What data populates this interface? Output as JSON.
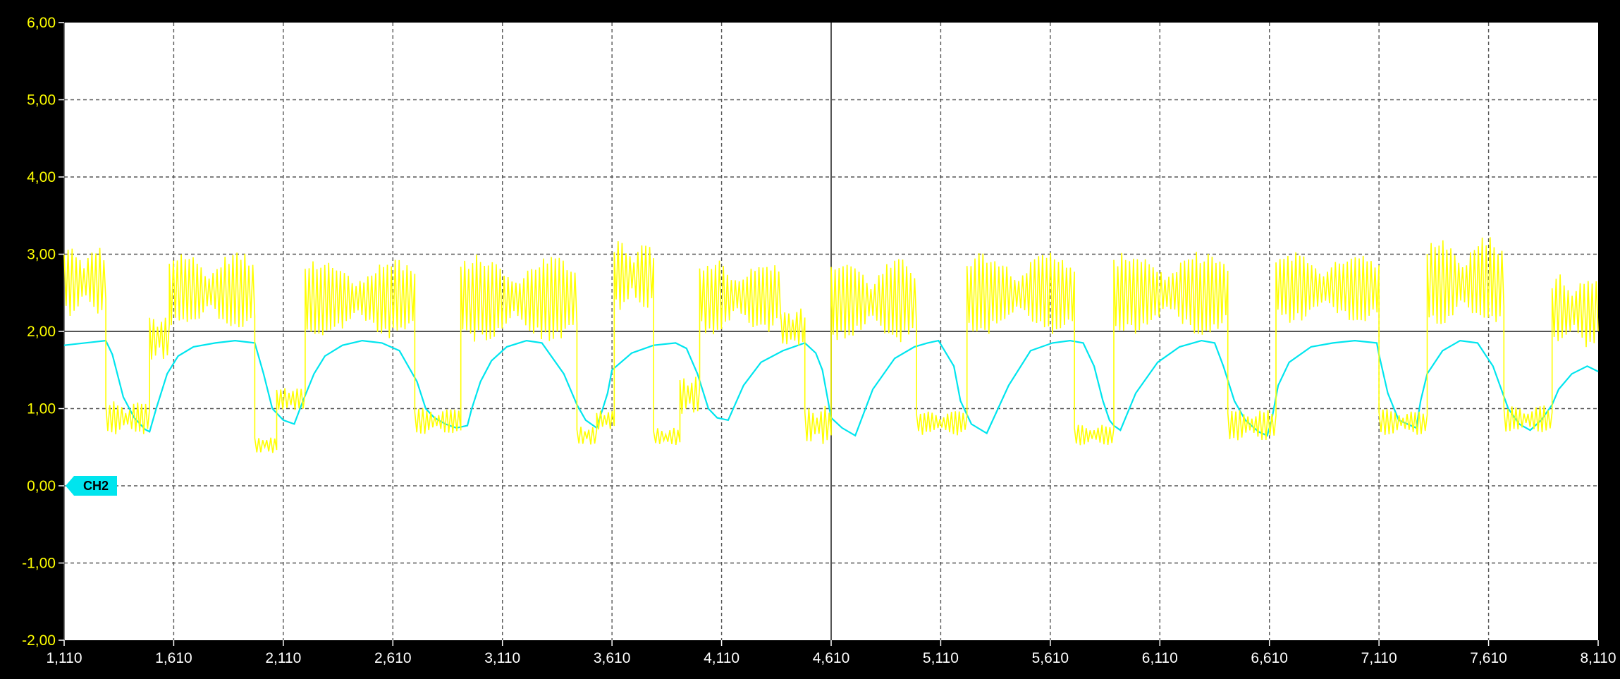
{
  "chart_data": {
    "type": "line",
    "title": "",
    "xlabel": "",
    "ylabel": "",
    "xlim": [
      1110,
      8110
    ],
    "ylim": [
      -2.0,
      6.0
    ],
    "grid": true,
    "x_ticks": [
      1110,
      1610,
      2110,
      2610,
      3110,
      3610,
      4110,
      4610,
      5110,
      5610,
      6110,
      6610,
      7110,
      7610,
      8110
    ],
    "x_tick_labels": [
      "1,110",
      "1,610",
      "2,110",
      "2,610",
      "3,110",
      "3,610",
      "4,110",
      "4,610",
      "5,110",
      "5,610",
      "6,110",
      "6,610",
      "7,110",
      "7,610",
      "8,110"
    ],
    "y_ticks": [
      6,
      5,
      4,
      3,
      2,
      1,
      0,
      -1,
      -2
    ],
    "y_tick_labels": [
      "6,00",
      "5,00",
      "4,00",
      "3,00",
      "2,00",
      "1,00",
      "0,00",
      "-1,00",
      "-2,00"
    ],
    "reference_lines": {
      "horizontal_y": 2.0,
      "vertical_x": 4610
    },
    "channel_marker": {
      "label": "CH2",
      "y": 0.0,
      "color": "#00e5ee"
    },
    "colors": {
      "background": "#000000",
      "plot_area": "#ffffff",
      "grid": "#555555",
      "reference": "#555555",
      "y_tick_text": "#ffff00",
      "x_tick_text": "#ffffff"
    },
    "series": [
      {
        "color": "#00e5ee",
        "x": [
          1110,
          1300,
          1330,
          1380,
          1430,
          1480,
          1500,
          1530,
          1580,
          1630,
          1700,
          1800,
          1890,
          1980,
          2020,
          2060,
          2110,
          2160,
          2200,
          2250,
          2300,
          2380,
          2470,
          2560,
          2640,
          2720,
          2760,
          2800,
          2850,
          2900,
          2950,
          2970,
          3010,
          3060,
          3130,
          3220,
          3290,
          3390,
          3450,
          3490,
          3540,
          3590,
          3610,
          3700,
          3800,
          3900,
          3950,
          4000,
          4050,
          4090,
          4140,
          4210,
          4290,
          4390,
          4490,
          4540,
          4570,
          4610,
          4660,
          4720,
          4800,
          4900,
          4990,
          5050,
          5100,
          5170,
          5200,
          5250,
          5320,
          5420,
          5520,
          5620,
          5700,
          5760,
          5810,
          5850,
          5880,
          5900,
          5930,
          6000,
          6100,
          6200,
          6300,
          6360,
          6400,
          6450,
          6500,
          6560,
          6600,
          6620,
          6650,
          6700,
          6800,
          6900,
          7000,
          7100,
          7110,
          7150,
          7200,
          7280,
          7300,
          7330,
          7400,
          7480,
          7560,
          7630,
          7700,
          7750,
          7800,
          7850,
          7900,
          7930,
          7990,
          8060,
          8110
        ],
        "y": [
          1.82,
          1.88,
          1.7,
          1.15,
          0.88,
          0.73,
          0.7,
          1.0,
          1.45,
          1.68,
          1.8,
          1.85,
          1.88,
          1.85,
          1.45,
          1.0,
          0.85,
          0.8,
          1.1,
          1.45,
          1.68,
          1.82,
          1.88,
          1.85,
          1.75,
          1.35,
          1.0,
          0.88,
          0.8,
          0.75,
          0.78,
          1.0,
          1.35,
          1.62,
          1.8,
          1.88,
          1.85,
          1.45,
          1.05,
          0.85,
          0.75,
          1.2,
          1.5,
          1.72,
          1.82,
          1.85,
          1.78,
          1.45,
          1.0,
          0.88,
          0.85,
          1.3,
          1.6,
          1.75,
          1.85,
          1.72,
          1.5,
          0.88,
          0.75,
          0.65,
          1.25,
          1.65,
          1.8,
          1.85,
          1.88,
          1.55,
          1.1,
          0.8,
          0.68,
          1.3,
          1.75,
          1.85,
          1.88,
          1.85,
          1.55,
          1.1,
          0.85,
          0.78,
          0.72,
          1.2,
          1.6,
          1.8,
          1.88,
          1.85,
          1.55,
          1.1,
          0.85,
          0.7,
          0.65,
          0.85,
          1.3,
          1.6,
          1.8,
          1.85,
          1.88,
          1.85,
          1.7,
          1.2,
          0.85,
          0.75,
          1.1,
          1.45,
          1.75,
          1.88,
          1.85,
          1.55,
          1.0,
          0.8,
          0.72,
          0.85,
          1.05,
          1.25,
          1.45,
          1.55,
          1.48
        ]
      },
      {
        "color": "#ffff00",
        "style": "noisy-square",
        "segments": [
          {
            "x0": 1110,
            "x1": 1300,
            "lo": 2.2,
            "hi": 3.12
          },
          {
            "x0": 1300,
            "x1": 1500,
            "lo": 0.65,
            "hi": 1.1
          },
          {
            "x0": 1500,
            "x1": 1590,
            "lo": 1.6,
            "hi": 2.25
          },
          {
            "x0": 1590,
            "x1": 1980,
            "lo": 2.0,
            "hi": 3.05
          },
          {
            "x0": 1980,
            "x1": 2080,
            "lo": 0.42,
            "hi": 0.65
          },
          {
            "x0": 2080,
            "x1": 2210,
            "lo": 0.95,
            "hi": 1.3
          },
          {
            "x0": 2210,
            "x1": 2710,
            "lo": 1.9,
            "hi": 2.95
          },
          {
            "x0": 2710,
            "x1": 2920,
            "lo": 0.65,
            "hi": 1.02
          },
          {
            "x0": 2920,
            "x1": 3450,
            "lo": 1.85,
            "hi": 3.0
          },
          {
            "x0": 3450,
            "x1": 3540,
            "lo": 0.52,
            "hi": 0.78
          },
          {
            "x0": 3540,
            "x1": 3620,
            "lo": 0.72,
            "hi": 1.0
          },
          {
            "x0": 3620,
            "x1": 3800,
            "lo": 2.25,
            "hi": 3.18
          },
          {
            "x0": 3800,
            "x1": 3920,
            "lo": 0.52,
            "hi": 0.75
          },
          {
            "x0": 3920,
            "x1": 4010,
            "lo": 0.9,
            "hi": 1.42
          },
          {
            "x0": 4010,
            "x1": 4380,
            "lo": 1.95,
            "hi": 2.95
          },
          {
            "x0": 4380,
            "x1": 4490,
            "lo": 1.75,
            "hi": 2.32
          },
          {
            "x0": 4490,
            "x1": 4610,
            "lo": 0.52,
            "hi": 1.05
          },
          {
            "x0": 4610,
            "x1": 5000,
            "lo": 1.85,
            "hi": 2.95
          },
          {
            "x0": 5000,
            "x1": 5230,
            "lo": 0.65,
            "hi": 0.98
          },
          {
            "x0": 5230,
            "x1": 5720,
            "lo": 1.95,
            "hi": 3.05
          },
          {
            "x0": 5720,
            "x1": 5900,
            "lo": 0.52,
            "hi": 0.8
          },
          {
            "x0": 5900,
            "x1": 6420,
            "lo": 1.95,
            "hi": 3.05
          },
          {
            "x0": 6420,
            "x1": 6640,
            "lo": 0.58,
            "hi": 1.0
          },
          {
            "x0": 6640,
            "x1": 7110,
            "lo": 2.1,
            "hi": 3.05
          },
          {
            "x0": 7110,
            "x1": 7330,
            "lo": 0.65,
            "hi": 1.0
          },
          {
            "x0": 7330,
            "x1": 7680,
            "lo": 2.0,
            "hi": 3.25
          },
          {
            "x0": 7680,
            "x1": 7900,
            "lo": 0.68,
            "hi": 1.05
          },
          {
            "x0": 7900,
            "x1": 8110,
            "lo": 1.75,
            "hi": 2.78
          }
        ]
      }
    ]
  }
}
